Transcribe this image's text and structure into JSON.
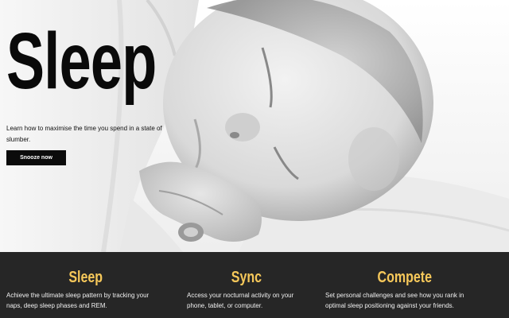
{
  "hero": {
    "title": "Sleep",
    "tagline": "Learn how to maximise the time you spend in a state of slumber.",
    "button_label": "Snooze now"
  },
  "features": [
    {
      "heading": "Sleep",
      "text": "Achieve the ultimate sleep pattern by tracking your naps, deep sleep phases and REM."
    },
    {
      "heading": "Sync",
      "text": "Access your nocturnal activity on your phone, tablet, or computer."
    },
    {
      "heading": "Compete",
      "text": "Set personal challenges and see how you rank in optimal sleep positioning against your friends."
    }
  ],
  "colors": {
    "accent": "#f6c85a",
    "features_background": "#262626",
    "button_background": "#0b0b0b"
  }
}
